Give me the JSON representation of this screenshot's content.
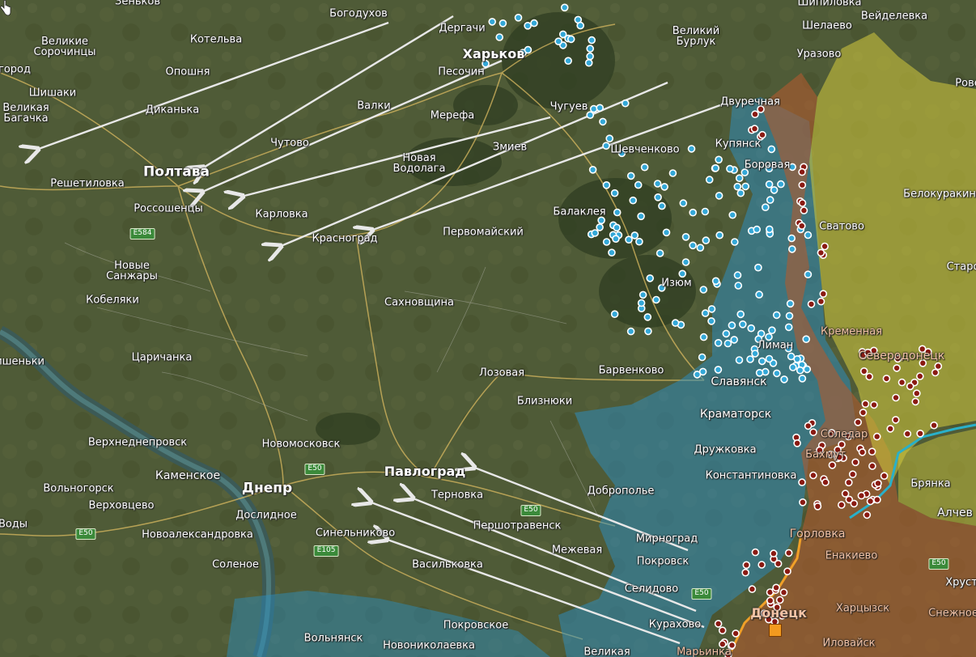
{
  "map": {
    "labels": [
      {
        "name": "zenkov",
        "text": "Зеньков"
      },
      {
        "name": "bogodukhov",
        "text": "Богодухов"
      },
      {
        "name": "dergachi",
        "text": "Дергачи"
      },
      {
        "name": "kharkov",
        "text": "Харьков"
      },
      {
        "name": "velikiy-burluk",
        "text": "Великий\nБурлук"
      },
      {
        "name": "shipilovka",
        "text": "Шипиловка"
      },
      {
        "name": "veydelevka",
        "text": "Вейделевка"
      },
      {
        "name": "shelaevo",
        "text": "Шелаево"
      },
      {
        "name": "urazovo",
        "text": "Уразово"
      },
      {
        "name": "rove",
        "text": "Рове"
      },
      {
        "name": "velikie-sorochintsy",
        "text": "Великие\nСорочинцы"
      },
      {
        "name": "kotelva",
        "text": "Котельва"
      },
      {
        "name": "gorod",
        "text": "город"
      },
      {
        "name": "oposhnya",
        "text": "Опошня"
      },
      {
        "name": "peschin",
        "text": "Песочин"
      },
      {
        "name": "shishaki",
        "text": "Шишаки"
      },
      {
        "name": "velikaya-bagachka",
        "text": "Великая\nБагачка"
      },
      {
        "name": "dikanka",
        "text": "Диканька"
      },
      {
        "name": "valki",
        "text": "Валки"
      },
      {
        "name": "merefa",
        "text": "Мерефа"
      },
      {
        "name": "chuguev",
        "text": "Чугуев"
      },
      {
        "name": "dvurechnaya",
        "text": "Двуречная"
      },
      {
        "name": "kupyansk",
        "text": "Купянск"
      },
      {
        "name": "shevchenkovo",
        "text": "Шевченково"
      },
      {
        "name": "borovaya",
        "text": "Боровая"
      },
      {
        "name": "belokurakino",
        "text": "Белокуракино"
      },
      {
        "name": "chutovo",
        "text": "Чутово"
      },
      {
        "name": "zmiev",
        "text": "Змиев"
      },
      {
        "name": "novaya-vodolaga",
        "text": "Новая\nВодолага"
      },
      {
        "name": "poltava",
        "text": "Полтава"
      },
      {
        "name": "reshetilovka",
        "text": "Решетиловка"
      },
      {
        "name": "rossoshentsy",
        "text": "Россошенцы"
      },
      {
        "name": "karlovka",
        "text": "Карловка"
      },
      {
        "name": "krasnograd",
        "text": "Красноград"
      },
      {
        "name": "pervomayskiy",
        "text": "Первомайский"
      },
      {
        "name": "balakleya",
        "text": "Балаклея"
      },
      {
        "name": "svatovo",
        "text": "Сватово"
      },
      {
        "name": "starobelsk",
        "text": "Старо"
      },
      {
        "name": "novye-sanzhary",
        "text": "Новые\nСанжары"
      },
      {
        "name": "kobelyaki",
        "text": "Кобеляки"
      },
      {
        "name": "sakhnovshchina",
        "text": "Сахновщина"
      },
      {
        "name": "izyum",
        "text": "Изюм"
      },
      {
        "name": "kremennaya",
        "text": "Кременная"
      },
      {
        "name": "severodonetsk",
        "text": "Северодонецк"
      },
      {
        "name": "limam",
        "text": "Лиман"
      },
      {
        "name": "kishenki",
        "text": "Кишеньки"
      },
      {
        "name": "tsarichanka",
        "text": "Царичанка"
      },
      {
        "name": "lozovaya",
        "text": "Лозовая"
      },
      {
        "name": "barvenkovo",
        "text": "Барвенково"
      },
      {
        "name": "slavyansk",
        "text": "Славянск"
      },
      {
        "name": "bliznyuki",
        "text": "Близнюки"
      },
      {
        "name": "kramatorsk",
        "text": "Краматорск"
      },
      {
        "name": "verkhnedneprovsk",
        "text": "Верхнеднепровск"
      },
      {
        "name": "novomoskovsk",
        "text": "Новомосковск"
      },
      {
        "name": "soledar",
        "text": "Соледар"
      },
      {
        "name": "druzhkovka",
        "text": "Дружковка"
      },
      {
        "name": "bakhmut",
        "text": "Бахмут"
      },
      {
        "name": "kamenskoe",
        "text": "Каменское"
      },
      {
        "name": "pavlograd",
        "text": "Павлоград"
      },
      {
        "name": "konstantinovka",
        "text": "Константиновка"
      },
      {
        "name": "dnepr",
        "text": "Днепр"
      },
      {
        "name": "bryanka",
        "text": "Брянка"
      },
      {
        "name": "volnogorsk",
        "text": "Вольногорск"
      },
      {
        "name": "ternovka",
        "text": "Терновка"
      },
      {
        "name": "dobropolie",
        "text": "Доброполье"
      },
      {
        "name": "verkhovtsevo",
        "text": "Верховцево"
      },
      {
        "name": "doslidnoe",
        "text": "Дослидное"
      },
      {
        "name": "alchevsk",
        "text": "Алчев"
      },
      {
        "name": "pershotravensk",
        "text": "Першотравенск"
      },
      {
        "name": "vody",
        "text": "Воды"
      },
      {
        "name": "novoaleksandrovka",
        "text": "Новоалександровка"
      },
      {
        "name": "sinelnikovo",
        "text": "Синельниково"
      },
      {
        "name": "gorlovka",
        "text": "Горловка"
      },
      {
        "name": "mirnograd",
        "text": "Мирноград"
      },
      {
        "name": "mezhevaya",
        "text": "Межевая"
      },
      {
        "name": "enakievo",
        "text": "Енакиево"
      },
      {
        "name": "pokrovsk",
        "text": "Покровск"
      },
      {
        "name": "solenoe",
        "text": "Соленое"
      },
      {
        "name": "vasilkovka",
        "text": "Васильковка"
      },
      {
        "name": "khrust",
        "text": "Хруст"
      },
      {
        "name": "selidovo",
        "text": "Селидово"
      },
      {
        "name": "donetsk",
        "text": "Донецк"
      },
      {
        "name": "khartsyzsk",
        "text": "Харцызск"
      },
      {
        "name": "snezhnoe",
        "text": "Снежное"
      },
      {
        "name": "kurakhovo",
        "text": "Курахово"
      },
      {
        "name": "pokrovskoe",
        "text": "Покровское"
      },
      {
        "name": "volnyansk",
        "text": "Вольнянск"
      },
      {
        "name": "novonikolaevka",
        "text": "Новониколаевка"
      },
      {
        "name": "velikaya-novoselka",
        "text": "Великая"
      },
      {
        "name": "marinka",
        "text": "Марьинка"
      },
      {
        "name": "ilovaysk",
        "text": "Иловайск"
      }
    ],
    "shields": [
      {
        "name": "road-e584",
        "text": "E584"
      },
      {
        "name": "road-e50-a",
        "text": "E50"
      },
      {
        "name": "road-e50-b",
        "text": "E50"
      },
      {
        "name": "road-e50-c",
        "text": "E50"
      },
      {
        "name": "road-e105",
        "text": "E105"
      },
      {
        "name": "road-e50-d",
        "text": "E50"
      },
      {
        "name": "road-e50-e",
        "text": "E50"
      }
    ],
    "colors": {
      "ukraine_control": "#2b90c6",
      "russia_control": "#b05a2f",
      "contested": "#c9c23c",
      "friendly_marker": "#34a8d8",
      "enemy_marker": "#8a1a12",
      "arrow": "#e8e8e8",
      "front_line": "#f0a028",
      "river": "#29b0c9"
    }
  }
}
